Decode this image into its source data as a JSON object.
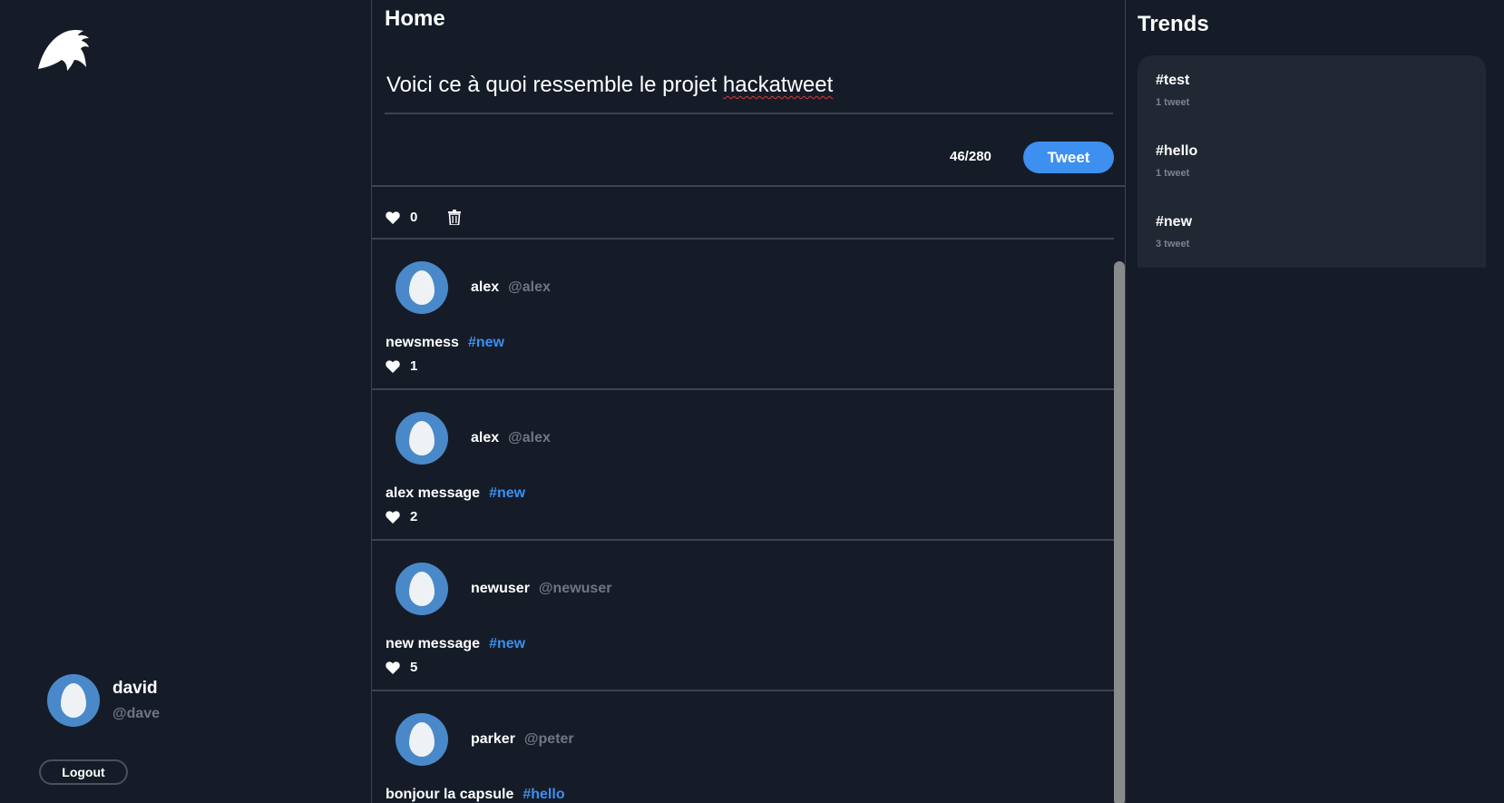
{
  "user": {
    "name": "david",
    "handle": "@dave",
    "logout_label": "Logout"
  },
  "header": {
    "title": "Home"
  },
  "compose": {
    "text_before": "Voici ce à quoi ressemble le projet ",
    "text_misspelled": "hackatweet",
    "counter": "46/280",
    "tweet_button": "Tweet"
  },
  "feed": {
    "partial_item": {
      "likes": "0"
    },
    "tweets": [
      {
        "name": "alex",
        "handle": "@alex",
        "message": "newsmess",
        "hashtag": "#new",
        "likes": "1"
      },
      {
        "name": "alex",
        "handle": "@alex",
        "message": "alex message",
        "hashtag": "#new",
        "likes": "2"
      },
      {
        "name": "newuser",
        "handle": "@newuser",
        "message": "new message",
        "hashtag": "#new",
        "likes": "5"
      },
      {
        "name": "parker",
        "handle": "@peter",
        "message": "bonjour la capsule",
        "hashtag": "#hello",
        "likes": ""
      }
    ]
  },
  "trends": {
    "title": "Trends",
    "items": [
      {
        "tag": "#test",
        "count": "1 tweet"
      },
      {
        "tag": "#hello",
        "count": "1 tweet"
      },
      {
        "tag": "#new",
        "count": "3 tweet"
      }
    ]
  },
  "colors": {
    "background": "#151c28",
    "accent": "#3d8ff0",
    "card": "#212833",
    "muted": "#6f7683"
  },
  "icons": {
    "logo": "feather-logo-icon",
    "like": "heart-icon",
    "delete": "trash-icon",
    "avatar": "egg-avatar-icon"
  }
}
